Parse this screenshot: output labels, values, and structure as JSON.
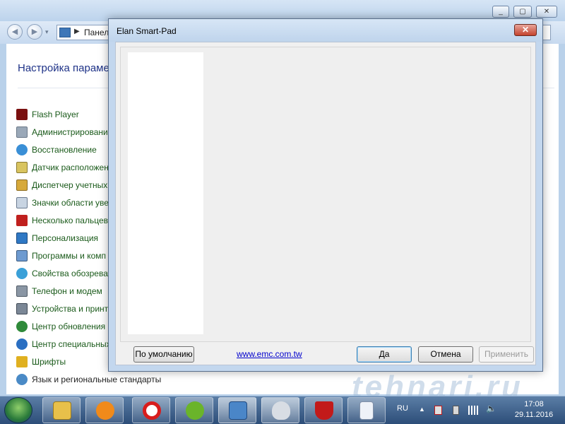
{
  "control_panel": {
    "address_text": "Панел",
    "heading": "Настройка параме",
    "items": [
      {
        "label": "Flash Player",
        "icon": "flash-player-icon"
      },
      {
        "label": "Администрировани",
        "icon": "admin-tools-icon"
      },
      {
        "label": "Восстановление",
        "icon": "recovery-icon"
      },
      {
        "label": "Датчик расположен",
        "icon": "location-sensor-icon"
      },
      {
        "label": "Диспетчер учетных",
        "icon": "credential-manager-icon"
      },
      {
        "label": "Значки области уве",
        "icon": "notification-icons-icon"
      },
      {
        "label": "Несколько пальцев",
        "icon": "multi-finger-icon"
      },
      {
        "label": "Персонализация",
        "icon": "personalization-icon"
      },
      {
        "label": "Программы и комп",
        "icon": "programs-features-icon"
      },
      {
        "label": "Свойства обозреват",
        "icon": "internet-options-icon"
      },
      {
        "label": "Телефон и модем",
        "icon": "phone-modem-icon"
      },
      {
        "label": "Устройства и принт",
        "icon": "devices-printers-icon"
      },
      {
        "label": "Центр обновления",
        "icon": "windows-update-icon"
      },
      {
        "label": "Центр специальных",
        "icon": "ease-of-access-icon"
      },
      {
        "label": "Шрифты",
        "icon": "fonts-icon"
      },
      {
        "label": "Язык и региональные стандарты",
        "icon": "region-language-icon"
      }
    ]
  },
  "dialog": {
    "title": "Elan Smart-Pad",
    "close_label": "✕",
    "defaults_button": "По умолчанию",
    "link_text": "www.emc.com.tw",
    "ok_button": "Да",
    "cancel_button": "Отмена",
    "apply_button": "Применить"
  },
  "watermark": "tehnari.ru",
  "taskbar": {
    "apps": [
      "explorer",
      "media-player",
      "opera",
      "utorrent",
      "control-panel",
      "mouse-settings",
      "mcafee",
      "document"
    ],
    "language": "RU",
    "time": "17:08",
    "date": "29.11.2016"
  },
  "colors": {
    "link": "#0000cc",
    "cp_link": "#1a5a1a",
    "close_button": "#c4432e"
  }
}
